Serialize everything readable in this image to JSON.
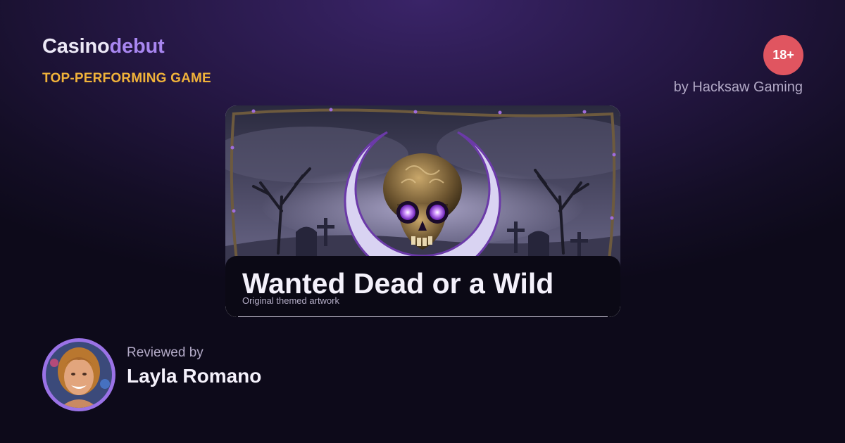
{
  "brand": {
    "name_part1": "Casino",
    "name_part2": "debut",
    "color_part1": "#ece8f6",
    "color_part2": "#a886f0"
  },
  "eyebrow": "TOP-PERFORMING GAME",
  "age_badge": "18+",
  "provider": "by Hacksaw Gaming",
  "game": {
    "title": "Wanted Dead or a Wild",
    "caption": "Original themed artwork",
    "artwork_icon": "glowing-skull-crescent-moon-graveyard"
  },
  "reviewer": {
    "label": "Reviewed by",
    "name": "Layla Romano",
    "avatar_icon": "reviewer-portrait"
  },
  "colors": {
    "accent": "#a886f0",
    "eyebrow": "#f0b23a",
    "badge": "#e05560",
    "background": "#251744"
  }
}
